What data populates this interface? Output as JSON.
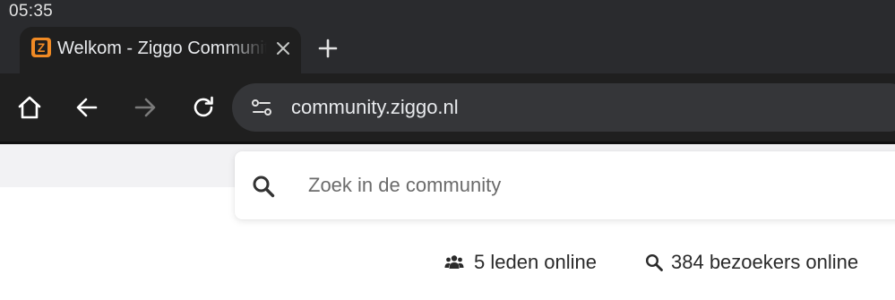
{
  "status_bar": {
    "time": "05:35"
  },
  "tab": {
    "title": "Welkom - Ziggo Community",
    "favicon_letter": "Z",
    "favicon_color": "#f08a24",
    "icons": {
      "close": "close-icon",
      "new_tab": "plus-icon"
    }
  },
  "toolbar": {
    "icons": [
      "home-icon",
      "back-arrow-icon",
      "forward-arrow-icon",
      "reload-icon",
      "site-info-icon"
    ],
    "url": "community.ziggo.nl"
  },
  "search": {
    "placeholder": "Zoek in de community",
    "icon": "search-icon"
  },
  "stats": {
    "members_online": "5 leden online",
    "visitors_online": "384 bezoekers online",
    "icons": [
      "members-icon",
      "search-icon"
    ]
  },
  "colors": {
    "browser_chrome": "#2a2b2e",
    "toolbar": "#1f1f1f",
    "omnibox": "#353639",
    "page_background": "#ffffff"
  }
}
